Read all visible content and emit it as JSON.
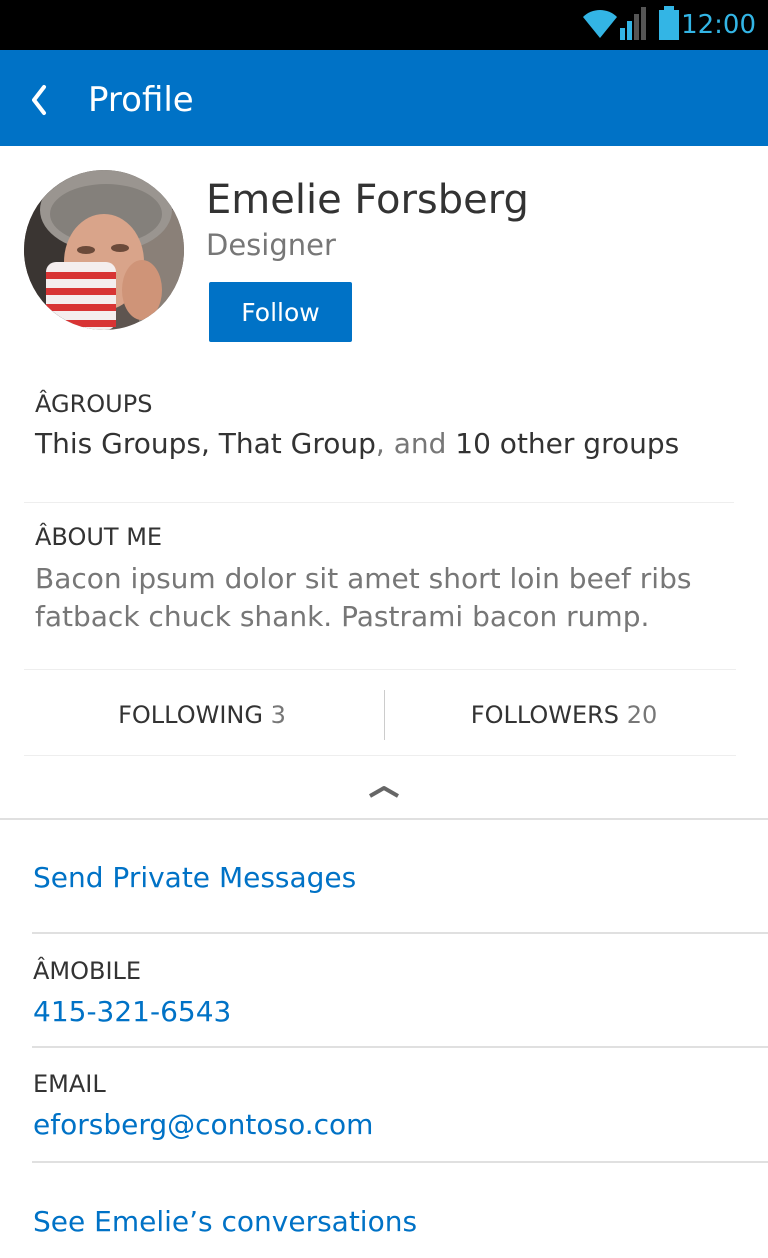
{
  "status_bar": {
    "time": "12:00",
    "icons": [
      "wifi-icon",
      "signal-icon",
      "battery-icon"
    ],
    "accent_color": "#33b5e5"
  },
  "header": {
    "title": "Profile",
    "back_icon": "chevron-left-icon",
    "color": "#0072c6"
  },
  "profile": {
    "name": "Emelie Forsberg",
    "title": "Designer",
    "follow_label": "Follow"
  },
  "groups": {
    "label": "ÂGROUPS",
    "named": "This Groups, That Group",
    "conjunction": ", and ",
    "others": "10 other groups"
  },
  "about": {
    "label": "ÂBOUT ME",
    "text": "Bacon ipsum dolor sit amet short loin beef ribs fatback chuck shank. Pastrami bacon rump."
  },
  "stats": {
    "following_label": "FOLLOWING",
    "following_count": "3",
    "followers_label": "FOLLOWERS",
    "followers_count": "20"
  },
  "actions": {
    "send_private_messages": "Send Private Messages",
    "see_conversations": "See Emelie’s conversations"
  },
  "contact": {
    "mobile_label": "ÂMOBILE",
    "mobile_value": "415-321-6543",
    "email_label": "EMAIL",
    "email_value": "eforsberg@contoso.com"
  },
  "link_color": "#0072c6"
}
